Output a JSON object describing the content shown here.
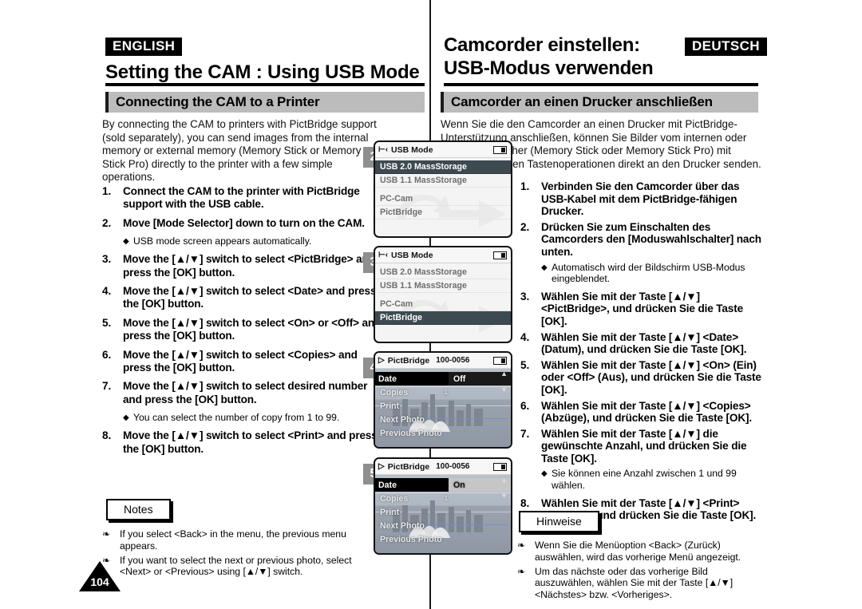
{
  "page": {
    "number": "104",
    "language_tag_left": "ENGLISH",
    "language_tag_right": "DEUTSCH"
  },
  "english": {
    "title": "Setting the CAM : Using USB Mode",
    "section_title": "Connecting the CAM to a Printer",
    "intro": "By connecting the CAM to printers with PictBridge support (sold separately), you can send images from the internal memory or external memory (Memory Stick or Memory Stick Pro) directly to the printer with a few simple operations.",
    "steps": [
      {
        "num": "1.",
        "text": "Connect the CAM to the printer with PictBridge support with the USB cable."
      },
      {
        "num": "2.",
        "text": "Move [Mode Selector] down to turn on the CAM.",
        "bullet": "USB mode screen appears automatically."
      },
      {
        "num": "3.",
        "text": "Move the [▲/▼] switch to select <PictBridge> and press the [OK] button."
      },
      {
        "num": "4.",
        "text": "Move the [▲/▼] switch to select <Date> and press the [OK] button."
      },
      {
        "num": "5.",
        "text": "Move the [▲/▼] switch to select <On> or <Off> and press the [OK] button."
      },
      {
        "num": "6.",
        "text": "Move the [▲/▼] switch to select <Copies> and press the [OK] button."
      },
      {
        "num": "7.",
        "text": "Move the [▲/▼] switch to select desired number and press the [OK] button.",
        "bullet": "You can select the number of copy from 1 to 99."
      },
      {
        "num": "8.",
        "text": "Move the [▲/▼] switch to select <Print> and press the [OK] button."
      }
    ],
    "notes_label": "Notes",
    "notes": [
      "If you select <Back> in the menu, the previous menu appears.",
      "If you want to select the next or previous photo, select <Next> or <Previous> using [▲/▼] switch."
    ]
  },
  "german": {
    "title_line1": "Camcorder einstellen:",
    "title_line2": "USB-Modus verwenden",
    "section_title": "Camcorder an einen Drucker anschließen",
    "intro": "Wenn Sie die den Camcorder an einen Drucker mit PictBridge-Unterstützung anschließen, können Sie Bilder vom internen oder externen Speicher (Memory Stick oder Memory Stick Pro) mit einigen einfachen Tastenoperationen direkt an den Drucker senden.",
    "steps": [
      {
        "num": "1.",
        "text": "Verbinden Sie den Camcorder über das USB-Kabel mit dem PictBridge-fähigen Drucker."
      },
      {
        "num": "2.",
        "text": "Drücken Sie zum Einschalten des Camcorders den [Moduswahlschalter] nach unten.",
        "bullet": "Automatisch wird der Bildschirm USB-Modus eingeblendet."
      },
      {
        "num": "3.",
        "text": "Wählen Sie mit der Taste [▲/▼] <PictBridge>, und drücken Sie die Taste [OK]."
      },
      {
        "num": "4.",
        "text": "Wählen Sie mit der Taste [▲/▼] <Date> (Datum), und drücken Sie die Taste [OK]."
      },
      {
        "num": "5.",
        "text": "Wählen Sie mit der Taste [▲/▼] <On> (Ein) oder <Off> (Aus), und drücken Sie die Taste [OK]."
      },
      {
        "num": "6.",
        "text": "Wählen Sie mit der Taste [▲/▼] <Copies> (Abzüge), und drücken Sie die Taste [OK]."
      },
      {
        "num": "7.",
        "text": "Wählen Sie mit der Taste [▲/▼] die gewünschte Anzahl, und drücken Sie die Taste [OK].",
        "bullet": "Sie können eine Anzahl zwischen 1 und 99 wählen."
      },
      {
        "num": "8.",
        "text": "Wählen Sie mit der Taste [▲/▼] <Print> (Drucken), und drücken Sie die Taste [OK]."
      }
    ],
    "notes_label": "Hinweise",
    "notes": [
      "Wenn Sie die Menüoption <Back> (Zurück) auswählen, wird das vorherige Menü angezeigt.",
      "Um das nächste oder das vorherige Bild auszuwählen, wählen Sie mit der Taste [▲/▼] <Nächstes> bzw. <Vorheriges>."
    ]
  },
  "screens": [
    {
      "badge": "2",
      "title": "USB Mode",
      "items": [
        {
          "label": "USB 2.0 MassStorage",
          "selected": true
        },
        {
          "label": "USB 1.1 MassStorage",
          "selected": false
        },
        {
          "label": "PC-Cam",
          "selected": false
        },
        {
          "label": "PictBridge",
          "selected": false
        }
      ]
    },
    {
      "badge": "3",
      "title": "USB Mode",
      "items": [
        {
          "label": "USB 2.0 MassStorage",
          "selected": false
        },
        {
          "label": "USB 1.1 MassStorage",
          "selected": false
        },
        {
          "label": "PC-Cam",
          "selected": false
        },
        {
          "label": "PictBridge",
          "selected": true
        }
      ]
    },
    {
      "badge": "4",
      "title": "PictBridge",
      "fileno": "100-0056",
      "rows": [
        {
          "label": "Date",
          "value": "Off",
          "value_style": "off",
          "highlight": true
        },
        {
          "label": "Copies",
          "value": "1",
          "highlight": false
        },
        {
          "label": "Print",
          "highlight": false
        },
        {
          "label": "Next Photo",
          "highlight": false
        },
        {
          "label": "Previous Photo",
          "highlight": false
        }
      ]
    },
    {
      "badge": "5",
      "title": "PictBridge",
      "fileno": "100-0056",
      "rows": [
        {
          "label": "Date",
          "value": "On",
          "value_style": "on",
          "highlight": true
        },
        {
          "label": "Copies",
          "value": "1",
          "highlight": false
        },
        {
          "label": "Print",
          "highlight": false
        },
        {
          "label": "Next Photo",
          "highlight": false
        },
        {
          "label": "Previous Photo",
          "highlight": false
        }
      ]
    }
  ],
  "colors": {
    "section_bar": "#bcbcbc",
    "selection": "#3d4a4f",
    "badge": "#8f8f8f"
  }
}
